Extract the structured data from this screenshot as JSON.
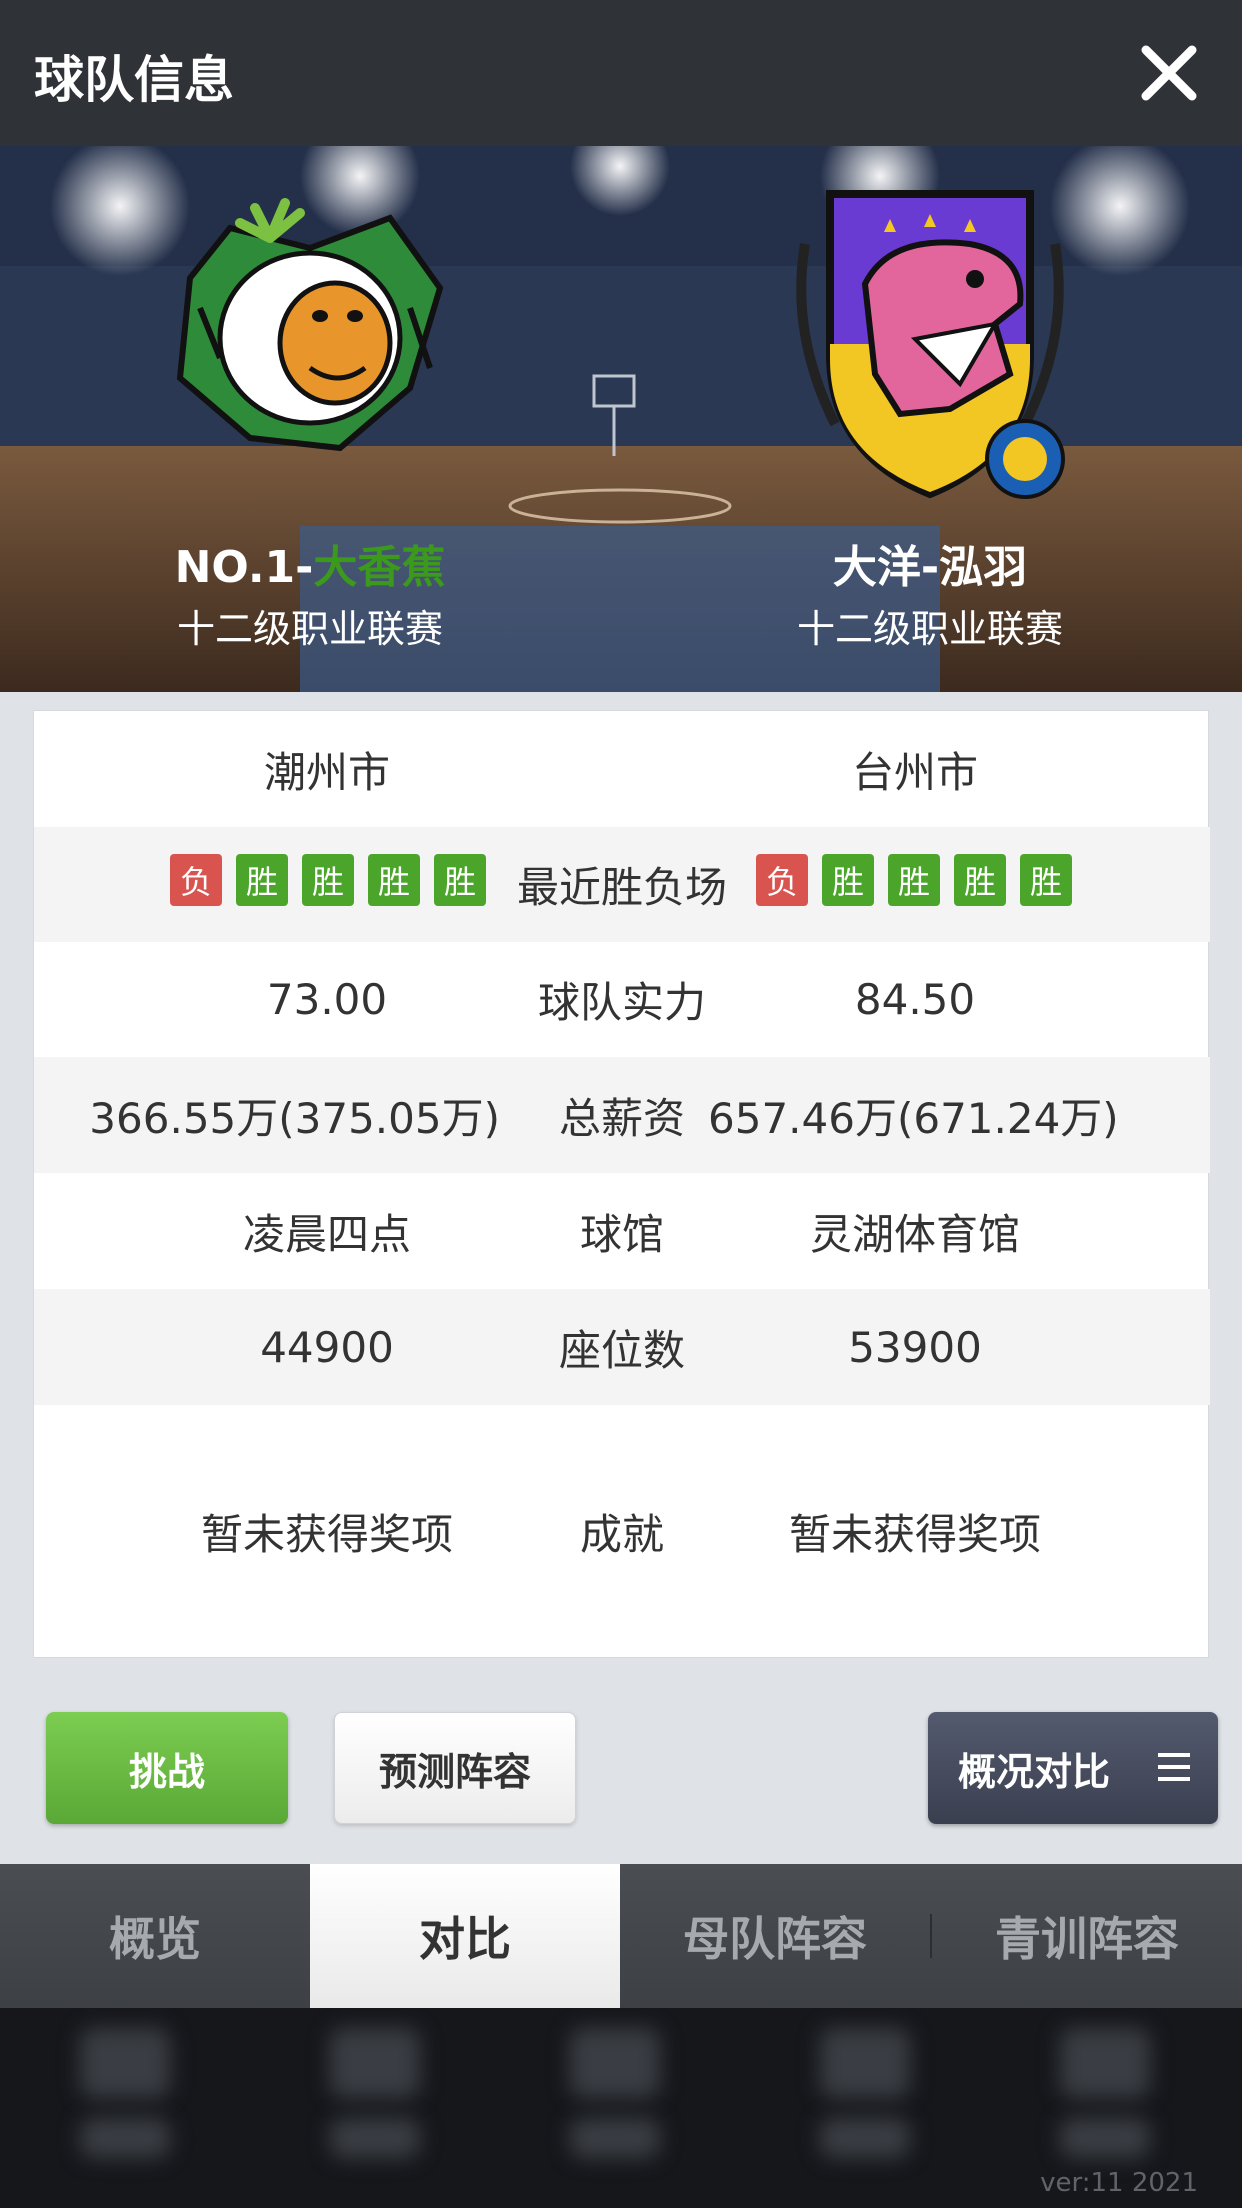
{
  "header": {
    "title": "球队信息",
    "close_icon": "close-icon"
  },
  "teams": {
    "left": {
      "name_prefix": "NO.1-",
      "name_highlight": "大香蕉",
      "league": "十二级职业联赛",
      "logo_icon": "gorilla-logo-icon"
    },
    "right": {
      "name": "大洋-泓羽",
      "league": "十二级职业联赛",
      "logo_icon": "dinosaur-logo-icon"
    }
  },
  "comparison": {
    "city": {
      "left": "潮州市",
      "right": "台州市"
    },
    "recent": {
      "label": "最近胜负场",
      "left": [
        "负",
        "胜",
        "胜",
        "胜",
        "胜"
      ],
      "right": [
        "负",
        "胜",
        "胜",
        "胜",
        "胜"
      ]
    },
    "strength": {
      "left": "73.00",
      "label": "球队实力",
      "right": "84.50"
    },
    "salary": {
      "left": "366.55万(375.05万)",
      "label": "总薪资",
      "right": "657.46万(671.24万)"
    },
    "arena": {
      "left": "凌晨四点",
      "label": "球馆",
      "right": "灵湖体育馆"
    },
    "seats": {
      "left": "44900",
      "label": "座位数",
      "right": "53900"
    },
    "achievements": {
      "left": "暂未获得奖项",
      "label": "成就",
      "right": "暂未获得奖项"
    }
  },
  "colors": {
    "win": "#4aa52a",
    "loss": "#d9534f",
    "accent_green": "#5aa836"
  },
  "actions": {
    "challenge": "挑战",
    "predict": "预测阵容",
    "compare": "概况对比",
    "compare_icon": "menu-icon"
  },
  "tabs": [
    {
      "label": "概览",
      "active": false
    },
    {
      "label": "对比",
      "active": true
    },
    {
      "label": "母队阵容",
      "active": false
    },
    {
      "label": "青训阵容",
      "active": false
    }
  ],
  "footer": {
    "version": "ver:11  2021"
  }
}
